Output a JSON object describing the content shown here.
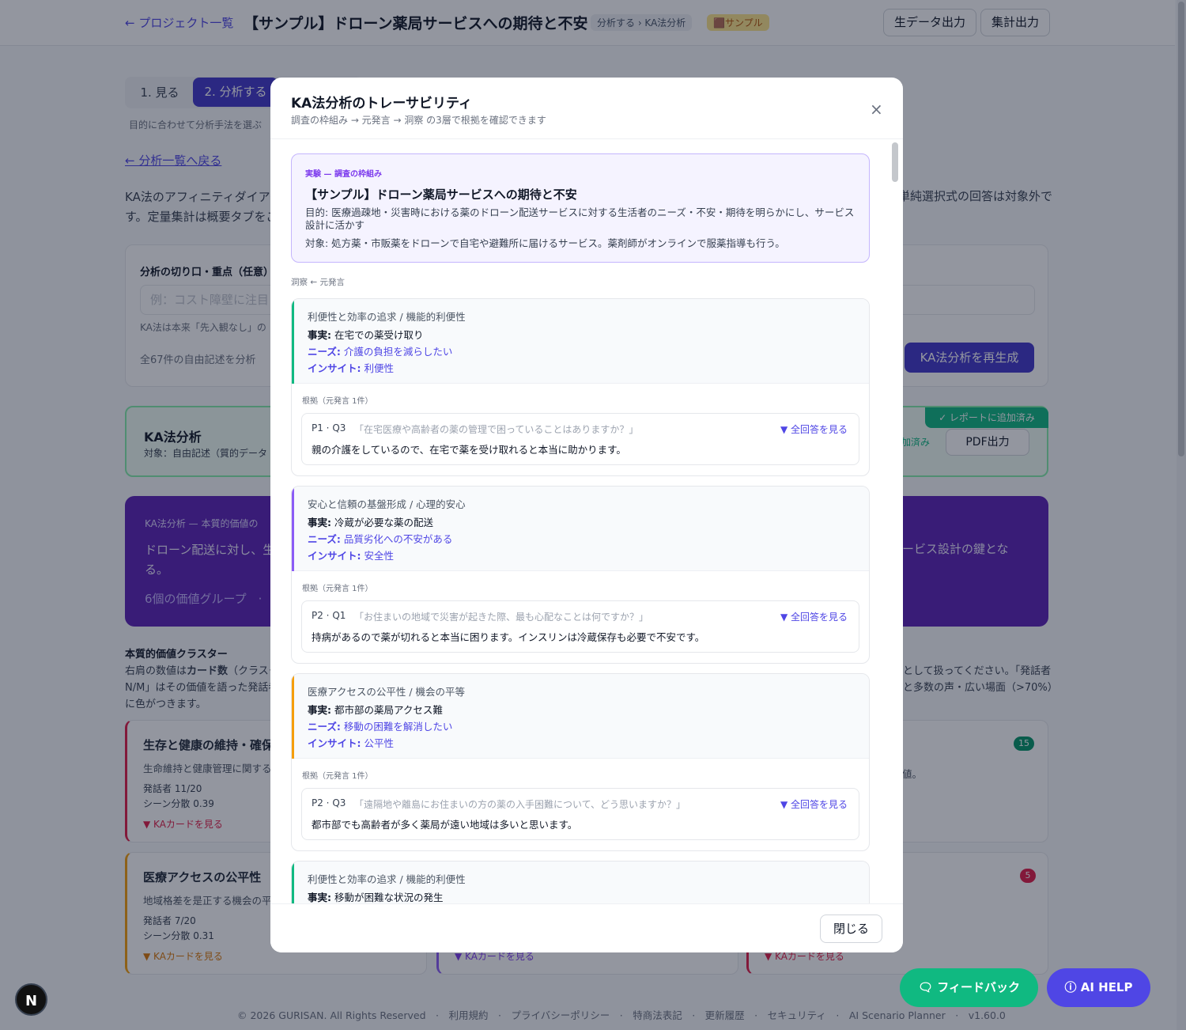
{
  "header": {
    "back": "← プロジェクト一覧",
    "title": "【サンプル】ドローン薬局サービスへの期待と不安",
    "crumb": "分析する › KA法分析",
    "badge": "🟫サンプル",
    "raw_export": "生データ出力",
    "agg_export": "集計出力"
  },
  "steps": {
    "s1": "1. 見る",
    "s2": "2. 分析する",
    "hint": "目的に合わせて分析手法を選ぶ"
  },
  "back_list": "← 分析一覧へ戻る",
  "intro_left": "KA法のアフィニティダイアグ",
  "intro_left2": "す。定量集計は概要タブをご",
  "intro_right": "単純選択式の回答は対象外で",
  "focus": {
    "label": "分析の切り口・重点（任意）",
    "placeholder": "例：コスト障壁に注目し",
    "note": "KA法は本来「先入観なし」の",
    "count": "全67件の自由記述を分析",
    "regen": "KA法分析を再生成"
  },
  "ka": {
    "title": "KA法分析",
    "sub": "対象：自由記述（質的データ",
    "added": "✓ レポートに追加済み",
    "added_btn": "加済み",
    "pdf": "PDF出力"
  },
  "purple": {
    "k": "KA法分析 — 本質的価値の",
    "text": "ドローン配送に対し、生",
    "text2": "る。",
    "right": "ービス設計の鍵とな",
    "groups": "6個の価値グループ　·"
  },
  "clusters": {
    "title": "本質的価値クラスター",
    "l1a": "右肩の数値は",
    "l1b": "カード数",
    "l1c": "（クラスタ",
    "l2": "N/M」はその価値を語った発話者",
    "l3": "に色がつきます。",
    "r1": "として扱ってください。「発話者",
    "r2": "と多数の声・広い場面（>70%）"
  },
  "c1": {
    "title": "生存と健康の維持・確保",
    "desc": "生命維持と健康管理に関する",
    "sp": "発話者 11/20",
    "sc": "シーン分散 0.39",
    "link": "▼ KAカードを見る",
    "right": "値。",
    "count": "15"
  },
  "c2": {
    "title": "医療アクセスの公平性",
    "desc": "地域格差を是正する機会の平",
    "sp": "発話者 7/20",
    "sc": "シーン分散 0.31",
    "link": "▼ KAカードを見る",
    "count": "5",
    "link2": "▼ KAカードを見る",
    "link3": "▼ KAカードを見る"
  },
  "modal": {
    "title": "KA法分析のトレーサビリティ",
    "sub": "調査の枠組み → 元発言 → 洞察 の3層で根拠を確認できます",
    "close_x": "×",
    "close": "閉じる",
    "exp_k": "実験 — 調査の枠組み",
    "exp_t": "【サンプル】ドローン薬局サービスへの期待と不安",
    "goal": "目的: 医療過疎地・災害時における薬のドローン配送サービスに対する生活者のニーズ・不安・期待を明らかにし、サービス設計に活かす",
    "obj": "対象: 処方薬・市販薬をドローンで自宅や避難所に届けるサービス。薬剤師がオンラインで服薬指導も行う。",
    "sec": "洞察 ← 元発言"
  },
  "insights": [
    {
      "cat": "利便性と効率の追求 / 機能的利便性",
      "fk": "事実:",
      "fact": " 在宅での薬受け取り",
      "nk": "ニーズ:",
      "need": " 介護の負担を減らしたい",
      "ik": "インサイト:",
      "insight": " 利便性",
      "ev": "根拠（元発言 1件）",
      "qid": "P1 · Q3",
      "q": "「在宅医療や高齢者の薬の管理で困っていることはありますか？」",
      "all": "▼ 全回答を見る",
      "a": "親の介護をしているので、在宅で薬を受け取れると本当に助かります。"
    },
    {
      "cat": "安心と信頼の基盤形成 / 心理的安心",
      "fk": "事実:",
      "fact": " 冷蔵が必要な薬の配送",
      "nk": "ニーズ:",
      "need": " 品質劣化への不安がある",
      "ik": "インサイト:",
      "insight": " 安全性",
      "ev": "根拠（元発言 1件）",
      "qid": "P2 · Q1",
      "q": "「お住まいの地域で災害が起きた際、最も心配なことは何ですか？」",
      "all": "▼ 全回答を見る",
      "a": "持病があるので薬が切れると本当に困ります。インスリンは冷蔵保存も必要で不安です。"
    },
    {
      "cat": "医療アクセスの公平性 / 機会の平等",
      "fk": "事実:",
      "fact": " 都市部の薬局アクセス難",
      "nk": "ニーズ:",
      "need": " 移動の困難を解消したい",
      "ik": "インサイト:",
      "insight": " 公平性",
      "ev": "根拠（元発言 1件）",
      "qid": "P2 · Q3",
      "q": "「遠隔地や離島にお住まいの方の薬の入手困難について、どう思いますか？」",
      "all": "▼ 全回答を見る",
      "a": "都市部でも高齢者が多く薬局が遠い地域は多いと思います。"
    },
    {
      "cat": "利便性と効率の追求 / 機能的利便性",
      "fk": "事実:",
      "fact": " 移動が困難な状況の発生"
    }
  ],
  "colors": {
    "bar1": "#10b981",
    "bar2": "#8b5cf6",
    "bar3": "#f59e0b",
    "bar4": "#10b981"
  },
  "fab": {
    "feedback": "🗨 フィードバック",
    "ai": "ⓘ AI HELP",
    "n": "N"
  },
  "footer": "© 2026 GURISAN. All Rights Reserved　·　利用規約　·　プライバシーポリシー　·　特商法表記　·　更新履歴　·　セキュリティ　·　AI Scenario Planner　·　v1.60.0"
}
